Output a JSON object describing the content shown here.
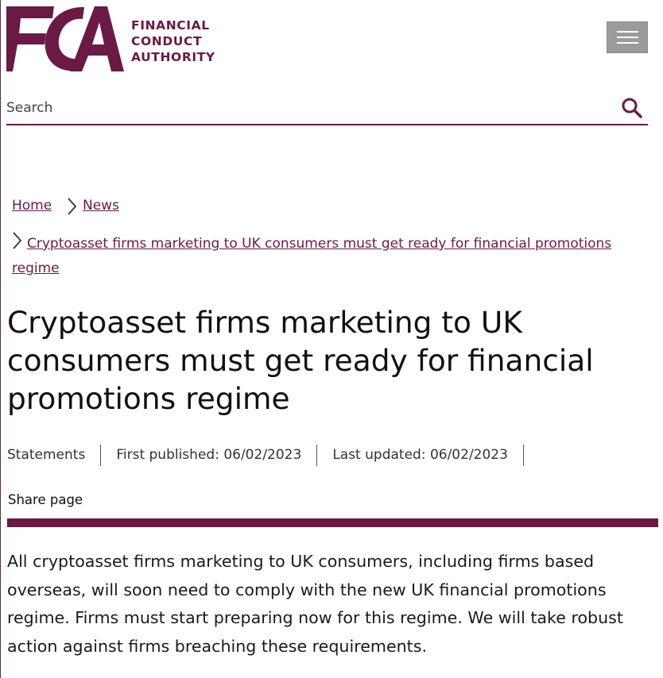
{
  "header": {
    "logo_lines": [
      "FINANCIAL",
      "CONDUCT",
      "AUTHORITY"
    ],
    "logo_mark_letters": "FCA",
    "brand_color": "#6a1a45",
    "menu_icon": "hamburger-icon"
  },
  "search": {
    "placeholder": "Search",
    "icon": "search-icon"
  },
  "breadcrumb": {
    "home": "Home",
    "news": "News",
    "current": "Cryptoasset firms marketing to UK consumers must get ready for financial promotions regime"
  },
  "article": {
    "title": "Cryptoasset firms marketing to UK consumers must get ready for financial promotions regime",
    "meta": {
      "type": "Statements",
      "first_published": "First published: 06/02/2023",
      "last_updated": "Last updated: 06/02/2023"
    },
    "share_label": "Share page",
    "intro": "All cryptoasset firms marketing to UK consumers, including firms based overseas, will soon need to comply with the new UK financial promotions regime. Firms must start preparing now for this regime. We will take robust action against firms breaching these requirements."
  }
}
